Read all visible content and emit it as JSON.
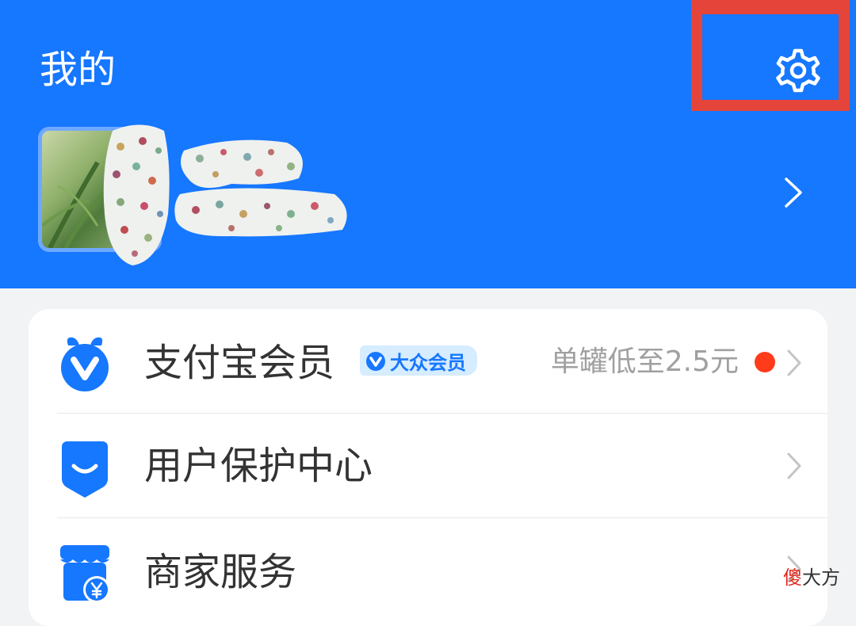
{
  "header": {
    "title": "我的",
    "background": "#1677ff",
    "settings_icon": "gear-icon",
    "highlight_color": "#e5443a"
  },
  "profile": {
    "avatar_icon": "avatar-photo",
    "name_redacted": true,
    "chevron_icon": "chevron-right-icon"
  },
  "menu": {
    "items": [
      {
        "label": "支付宝会员",
        "icon": "membership-v-icon",
        "badge": "大众会员",
        "subtitle": "单罐低至2.5元",
        "has_red_dot": true
      },
      {
        "label": "用户保护中心",
        "icon": "shield-smile-icon"
      },
      {
        "label": "商家服务",
        "icon": "store-yuan-icon"
      }
    ]
  },
  "watermark": {
    "accent": "傻",
    "rest": "大方"
  },
  "colors": {
    "brand": "#1677ff",
    "red_dot": "#ff3b1a",
    "subtitle": "#a0a0a0",
    "label": "#333333"
  }
}
